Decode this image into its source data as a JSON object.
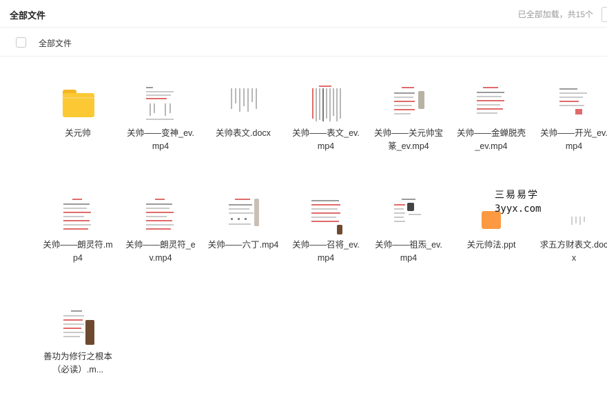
{
  "header": {
    "title": "全部文件",
    "status": "已全部加载，共15个"
  },
  "selection_bar": {
    "label": "全部文件"
  },
  "watermark": {
    "line1": "三易易学",
    "line2": "3yyx.com"
  },
  "files": [
    {
      "name": "关元帅",
      "type": "folder",
      "icon": "folder-icon"
    },
    {
      "name": "关帅——变神_ev.mp4",
      "type": "video",
      "icon": "video-thumbnail"
    },
    {
      "name": "关帅表文.docx",
      "type": "docx",
      "icon": "docx-thumbnail"
    },
    {
      "name": "关帅——表文_ev.mp4",
      "type": "video",
      "icon": "video-thumbnail"
    },
    {
      "name": "关帅——关元帅宝篆_ev.mp4",
      "type": "video",
      "icon": "video-thumbnail"
    },
    {
      "name": "关帅——金蝉脱壳_ev.mp4",
      "type": "video",
      "icon": "video-thumbnail"
    },
    {
      "name": "关帅——开光_ev.mp4",
      "type": "video",
      "icon": "video-thumbnail"
    },
    {
      "name": "关帅——朗灵符.mp4",
      "type": "video",
      "icon": "video-thumbnail"
    },
    {
      "name": "关帅——朗灵符_ev.mp4",
      "type": "video",
      "icon": "video-thumbnail"
    },
    {
      "name": "关帅——六丁.mp4",
      "type": "video",
      "icon": "video-thumbnail"
    },
    {
      "name": "关帅——召将_ev.mp4",
      "type": "video",
      "icon": "video-thumbnail"
    },
    {
      "name": "关帅——祖炁_ev.mp4",
      "type": "video",
      "icon": "video-thumbnail"
    },
    {
      "name": "关元帅法.ppt",
      "type": "ppt",
      "icon": "ppt-icon"
    },
    {
      "name": "求五方财表文.docx",
      "type": "docx",
      "icon": "docx-thumbnail"
    },
    {
      "name": "善功为修行之根本（必读）.m...",
      "type": "video",
      "icon": "video-thumbnail"
    }
  ],
  "colors": {
    "folder": "#fcc935",
    "ppt": "#fb9a43",
    "accent_red": "#e06a6a"
  }
}
